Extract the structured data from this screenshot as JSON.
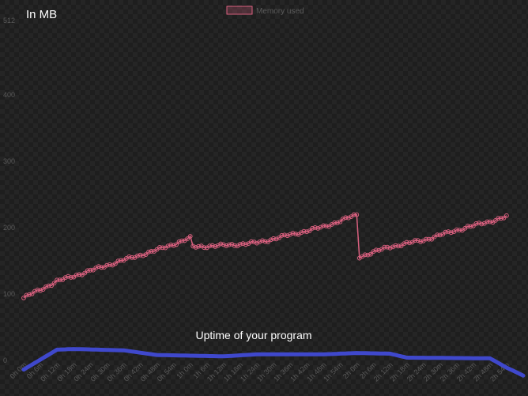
{
  "panel": {
    "title": "In MB",
    "subtitle": "Uptime of your program"
  },
  "colors": {
    "memory_line": "#d9607f",
    "uptime_line": "#3f48cc",
    "axis_text": "#5a5a5a"
  },
  "chart_data": {
    "type": "line",
    "ylim": [
      0,
      512
    ],
    "y_ticks": [
      {
        "value": 0,
        "label": "0"
      },
      {
        "value": 100,
        "label": "100"
      },
      {
        "value": 200,
        "label": "200"
      },
      {
        "value": 300,
        "label": "300"
      },
      {
        "value": 400,
        "label": "400"
      },
      {
        "value": 512,
        "label": "512"
      }
    ],
    "x_tick_labels": [
      "0h 0m",
      "0h 6m",
      "0h 12m",
      "0h 18m",
      "0h 24m",
      "0h 30m",
      "0h 36m",
      "0h 42m",
      "0h 48m",
      "0h 54m",
      "1h 0m",
      "1h 6m",
      "1h 12m",
      "1h 18m",
      "1h 24m",
      "1h 30m",
      "1h 36m",
      "1h 42m",
      "1h 48m",
      "1h 54m",
      "2h 0m",
      "2h 6m",
      "2h 12m",
      "2h 18m",
      "2h 24m",
      "2h 30m",
      "2h 36m",
      "2h 42m",
      "2h 48m",
      "2h 54m"
    ],
    "legend_position": "top-center",
    "series": [
      {
        "name": "Memory used",
        "x_minutes_start": 0,
        "x_minutes_end": 174,
        "anchors": [
          {
            "t": 0,
            "v": 93
          },
          {
            "t": 12,
            "v": 118
          },
          {
            "t": 24,
            "v": 134
          },
          {
            "t": 36,
            "v": 150
          },
          {
            "t": 48,
            "v": 165
          },
          {
            "t": 60,
            "v": 183
          },
          {
            "t": 61,
            "v": 170
          },
          {
            "t": 72,
            "v": 172
          },
          {
            "t": 84,
            "v": 176
          },
          {
            "t": 96,
            "v": 188
          },
          {
            "t": 108,
            "v": 200
          },
          {
            "t": 120,
            "v": 218
          },
          {
            "t": 121,
            "v": 155
          },
          {
            "t": 132,
            "v": 170
          },
          {
            "t": 144,
            "v": 180
          },
          {
            "t": 156,
            "v": 195
          },
          {
            "t": 174,
            "v": 215
          }
        ]
      },
      {
        "name": "Uptime",
        "anchors": [
          {
            "t": 0,
            "v": -15
          },
          {
            "t": 12,
            "v": 15
          },
          {
            "t": 18,
            "v": 16
          },
          {
            "t": 36,
            "v": 14
          },
          {
            "t": 48,
            "v": 7
          },
          {
            "t": 72,
            "v": 5
          },
          {
            "t": 84,
            "v": 8
          },
          {
            "t": 108,
            "v": 8
          },
          {
            "t": 120,
            "v": 10
          },
          {
            "t": 132,
            "v": 9
          },
          {
            "t": 138,
            "v": 3
          },
          {
            "t": 168,
            "v": 2
          },
          {
            "t": 174,
            "v": -12
          }
        ]
      }
    ]
  }
}
